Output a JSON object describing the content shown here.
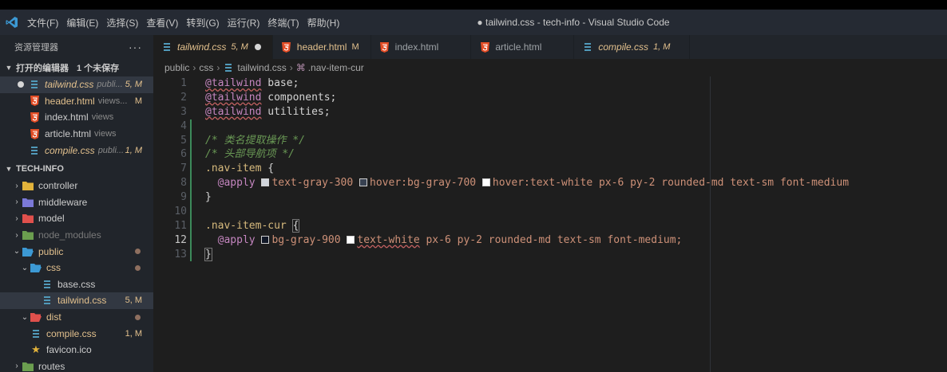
{
  "window": {
    "title": "● tailwind.css - tech-info - Visual Studio Code",
    "menu": [
      "文件(F)",
      "编辑(E)",
      "选择(S)",
      "查看(V)",
      "转到(G)",
      "运行(R)",
      "终端(T)",
      "帮助(H)"
    ]
  },
  "sidebar": {
    "title": "资源管理器",
    "more": "···",
    "open_editors": {
      "label": "打开的编辑器",
      "unsaved": "1 个未保存",
      "items": [
        {
          "name": "tailwind.css",
          "desc": "publi...",
          "badge": "5, M"
        },
        {
          "name": "header.html",
          "desc": "views...",
          "badge": "M"
        },
        {
          "name": "index.html",
          "desc": "views",
          "badge": ""
        },
        {
          "name": "article.html",
          "desc": "views",
          "badge": ""
        },
        {
          "name": "compile.css",
          "desc": "publi...",
          "badge": "1, M"
        }
      ]
    },
    "project": {
      "label": "TECH-INFO",
      "items": [
        {
          "name": "controller"
        },
        {
          "name": "middleware"
        },
        {
          "name": "model"
        },
        {
          "name": "node_modules"
        },
        {
          "name": "public"
        },
        {
          "name": "css"
        },
        {
          "name": "base.css"
        },
        {
          "name": "tailwind.css",
          "badge": "5, M"
        },
        {
          "name": "dist"
        },
        {
          "name": "compile.css",
          "badge": "1, M"
        },
        {
          "name": "favicon.ico"
        },
        {
          "name": "routes"
        }
      ]
    }
  },
  "tabs": [
    {
      "name": "tailwind.css",
      "desc": "5, M"
    },
    {
      "name": "header.html",
      "desc": "M"
    },
    {
      "name": "index.html",
      "desc": ""
    },
    {
      "name": "article.html",
      "desc": ""
    },
    {
      "name": "compile.css",
      "desc": "1, M"
    }
  ],
  "breadcrumb": [
    "public",
    "css",
    "tailwind.css",
    ".nav-item-cur"
  ],
  "editor": {
    "line_numbers": [
      "1",
      "2",
      "3",
      "4",
      "5",
      "6",
      "7",
      "8",
      "9",
      "10",
      "11",
      "12",
      "13"
    ],
    "code": {
      "l1_kw": "@tailwind",
      "l1_rest": " base;",
      "l2_kw": "@tailwind",
      "l2_rest": " components;",
      "l3_kw": "@tailwind",
      "l3_rest": " utilities;",
      "l5": "/* 类名提取操作 */",
      "l6": "/* 头部导航项 */",
      "l7_sel": ".nav-item",
      "l7_brace": " {",
      "l8_kw": "@apply",
      "l8_a": "text-gray-300",
      "l8_b_pre": "hover",
      "l8_b": ":bg-gray-700",
      "l8_c": "hover:text-white px-6 py-2 rounded-md text-sm font-medium",
      "l9": "}",
      "l11_sel": ".nav-item-cur",
      "l11_brace": "{",
      "l12_kw": "@apply",
      "l12_a": "bg-gray-900",
      "l12_b": "text-white",
      "l12_c": " px-6 py-2 rounded-md text-sm font-medium;",
      "l13": "}"
    }
  },
  "colors": {
    "accent_modified": "#e2c08d",
    "css_icon": "#519aba",
    "html_icon": "#e44d26",
    "vscode_logo": "#3c99d4"
  }
}
